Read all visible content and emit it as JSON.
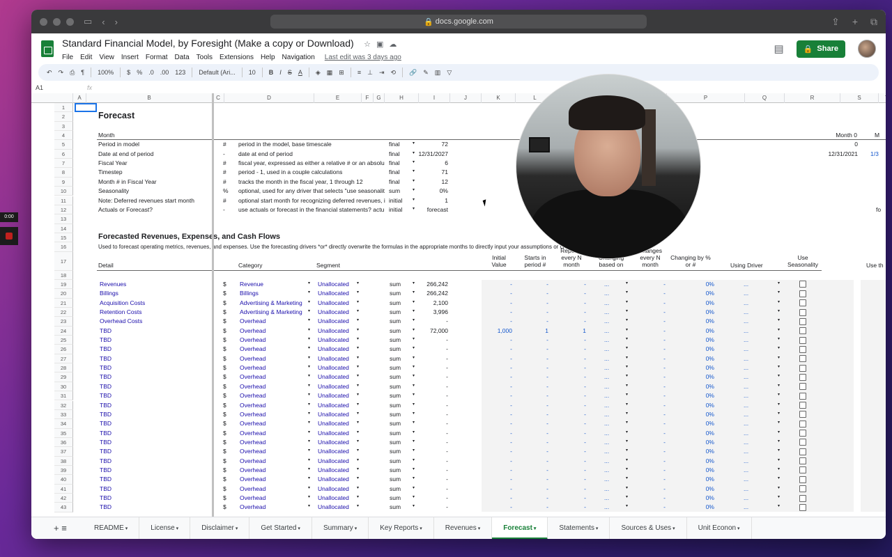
{
  "browser": {
    "url": "docs.google.com"
  },
  "app": {
    "title": "Standard Financial Model, by Foresight (Make a copy or Download)",
    "last_edit": "Last edit was 3 days ago",
    "share_label": "Share",
    "menu": [
      "File",
      "Edit",
      "View",
      "Insert",
      "Format",
      "Data",
      "Tools",
      "Extensions",
      "Help",
      "Navigation"
    ]
  },
  "toolbar": {
    "zoom": "100%",
    "currency": "$",
    "percent": "%",
    "dec_less": ".0",
    "dec_more": ".00",
    "format": "123",
    "font": "Default (Ari...",
    "font_size": "10"
  },
  "formula": {
    "cell": "A1",
    "fx": "fx"
  },
  "columns": [
    "A",
    "B",
    "C",
    "D",
    "E",
    "F",
    "G",
    "H",
    "I",
    "J",
    "K",
    "L",
    "M",
    "N",
    "O",
    "P",
    "Q",
    "R",
    "S",
    "T"
  ],
  "side": {
    "timer": "0:00"
  },
  "sheet": {
    "forecast_title": "Forecast",
    "month": "Month",
    "month0": "Month 0",
    "m_cut": "M",
    "section2": "Forecasted Revenues, Expenses, and Cash Flows",
    "section2_desc": "Used to forecast operating metrics, revenues, and expenses. Use the forecasting drivers *or* directly overwrite the formulas in the appropriate months to directly input your assumptions or create your own logic.",
    "meta_rows": [
      {
        "b": "Period in model",
        "c": "#",
        "d": "period in the model, base timescale",
        "h": "final",
        "i": "72"
      },
      {
        "b": "Date at end of period",
        "c": "-",
        "d": "date at end of period",
        "h": "final",
        "i": "12/31/2027"
      },
      {
        "b": "Fiscal Year",
        "c": "#",
        "d": "fiscal year, expressed as either a relative # or an absolu",
        "h": "final",
        "i": "6"
      },
      {
        "b": "Timestep",
        "c": "#",
        "d": "period - 1, used in a couple calculations",
        "h": "final",
        "i": "71"
      },
      {
        "b": "Month # in Fiscal Year",
        "c": "#",
        "d": "tracks the month in the fiscal year, 1 through 12",
        "h": "final",
        "i": "12"
      },
      {
        "b": "Seasonality",
        "c": "%",
        "d": "optional, used for any driver that selects \"use seasonalit",
        "h": "sum",
        "i": "0%"
      },
      {
        "b": "Note: Deferred revenues start month",
        "c": "#",
        "d": "optional start month for recognizing deferred revenues, i",
        "h": "initial",
        "i": "1"
      },
      {
        "b": "Actuals or Forecast?",
        "c": "-",
        "d": "use actuals or forecast in the financial statements? actu",
        "h": "initial",
        "i": "forecast"
      }
    ],
    "s_vals": {
      "r5": "0",
      "r6": "12/31/2021",
      "r6t": "1/3",
      "r12": "fo"
    },
    "headers": {
      "detail": "Detail",
      "category": "Category",
      "segment": "Segment",
      "initial": "Initial Value",
      "starts": "Starts in period #",
      "repeats": "Repeats every N month",
      "changing": "Changing based on",
      "changes": "Changes every N month",
      "changing_by": "Changing by % or #",
      "driver": "Using Driver",
      "use_season": "Use Seasonality",
      "use_t": "Use th"
    },
    "data_rows": [
      {
        "b": "Revenues",
        "d": "Revenue",
        "i": "266,242",
        "k": "-",
        "l": "-",
        "m": "-"
      },
      {
        "b": "Billings",
        "d": "Billings",
        "i": "266,242",
        "k": "-",
        "l": "-",
        "m": "-"
      },
      {
        "b": "Acquisition Costs",
        "d": "Advertising & Marketing",
        "i": "2,100",
        "k": "-",
        "l": "-",
        "m": "-"
      },
      {
        "b": "Retention Costs",
        "d": "Advertising & Marketing",
        "i": "3,996",
        "k": "-",
        "l": "-",
        "m": "-"
      },
      {
        "b": "Overhead Costs",
        "d": "Overhead",
        "i": "-",
        "k": "-",
        "l": "-",
        "m": "-"
      },
      {
        "b": "TBD",
        "d": "Overhead",
        "i": "72,000",
        "k": "1,000",
        "l": "1",
        "m": "1"
      },
      {
        "b": "TBD",
        "d": "Overhead",
        "i": "-",
        "k": "-",
        "l": "-",
        "m": "-"
      },
      {
        "b": "TBD",
        "d": "Overhead",
        "i": "-",
        "k": "-",
        "l": "-",
        "m": "-"
      },
      {
        "b": "TBD",
        "d": "Overhead",
        "i": "-",
        "k": "-",
        "l": "-",
        "m": "-"
      },
      {
        "b": "TBD",
        "d": "Overhead",
        "i": "-",
        "k": "-",
        "l": "-",
        "m": "-"
      },
      {
        "b": "TBD",
        "d": "Overhead",
        "i": "-",
        "k": "-",
        "l": "-",
        "m": "-"
      },
      {
        "b": "TBD",
        "d": "Overhead",
        "i": "-",
        "k": "-",
        "l": "-",
        "m": "-"
      },
      {
        "b": "TBD",
        "d": "Overhead",
        "i": "-",
        "k": "-",
        "l": "-",
        "m": "-"
      },
      {
        "b": "TBD",
        "d": "Overhead",
        "i": "-",
        "k": "-",
        "l": "-",
        "m": "-"
      },
      {
        "b": "TBD",
        "d": "Overhead",
        "i": "-",
        "k": "-",
        "l": "-",
        "m": "-"
      },
      {
        "b": "TBD",
        "d": "Overhead",
        "i": "-",
        "k": "-",
        "l": "-",
        "m": "-"
      },
      {
        "b": "TBD",
        "d": "Overhead",
        "i": "-",
        "k": "-",
        "l": "-",
        "m": "-"
      },
      {
        "b": "TBD",
        "d": "Overhead",
        "i": "-",
        "k": "-",
        "l": "-",
        "m": "-"
      },
      {
        "b": "TBD",
        "d": "Overhead",
        "i": "-",
        "k": "-",
        "l": "-",
        "m": "-"
      },
      {
        "b": "TBD",
        "d": "Overhead",
        "i": "-",
        "k": "-",
        "l": "-",
        "m": "-"
      },
      {
        "b": "TBD",
        "d": "Overhead",
        "i": "-",
        "k": "-",
        "l": "-",
        "m": "-"
      },
      {
        "b": "TBD",
        "d": "Overhead",
        "i": "-",
        "k": "-",
        "l": "-",
        "m": "-"
      },
      {
        "b": "TBD",
        "d": "Overhead",
        "i": "-",
        "k": "-",
        "l": "-",
        "m": "-"
      },
      {
        "b": "TBD",
        "d": "Overhead",
        "i": "-",
        "k": "-",
        "l": "-",
        "m": "-"
      },
      {
        "b": "TBD",
        "d": "Overhead",
        "i": "-",
        "k": "-",
        "l": "-",
        "m": "-"
      }
    ],
    "row_consts": {
      "c": "$",
      "e": "Unallocated",
      "h": "sum",
      "n": "...",
      "o": "-",
      "p": "0%",
      "q": "..."
    }
  },
  "tabs": [
    "README",
    "License",
    "Disclaimer",
    "Get Started",
    "Summary",
    "Key Reports",
    "Revenues",
    "Forecast",
    "Statements",
    "Sources & Uses",
    "Unit Econon"
  ],
  "active_tab": "Forecast"
}
